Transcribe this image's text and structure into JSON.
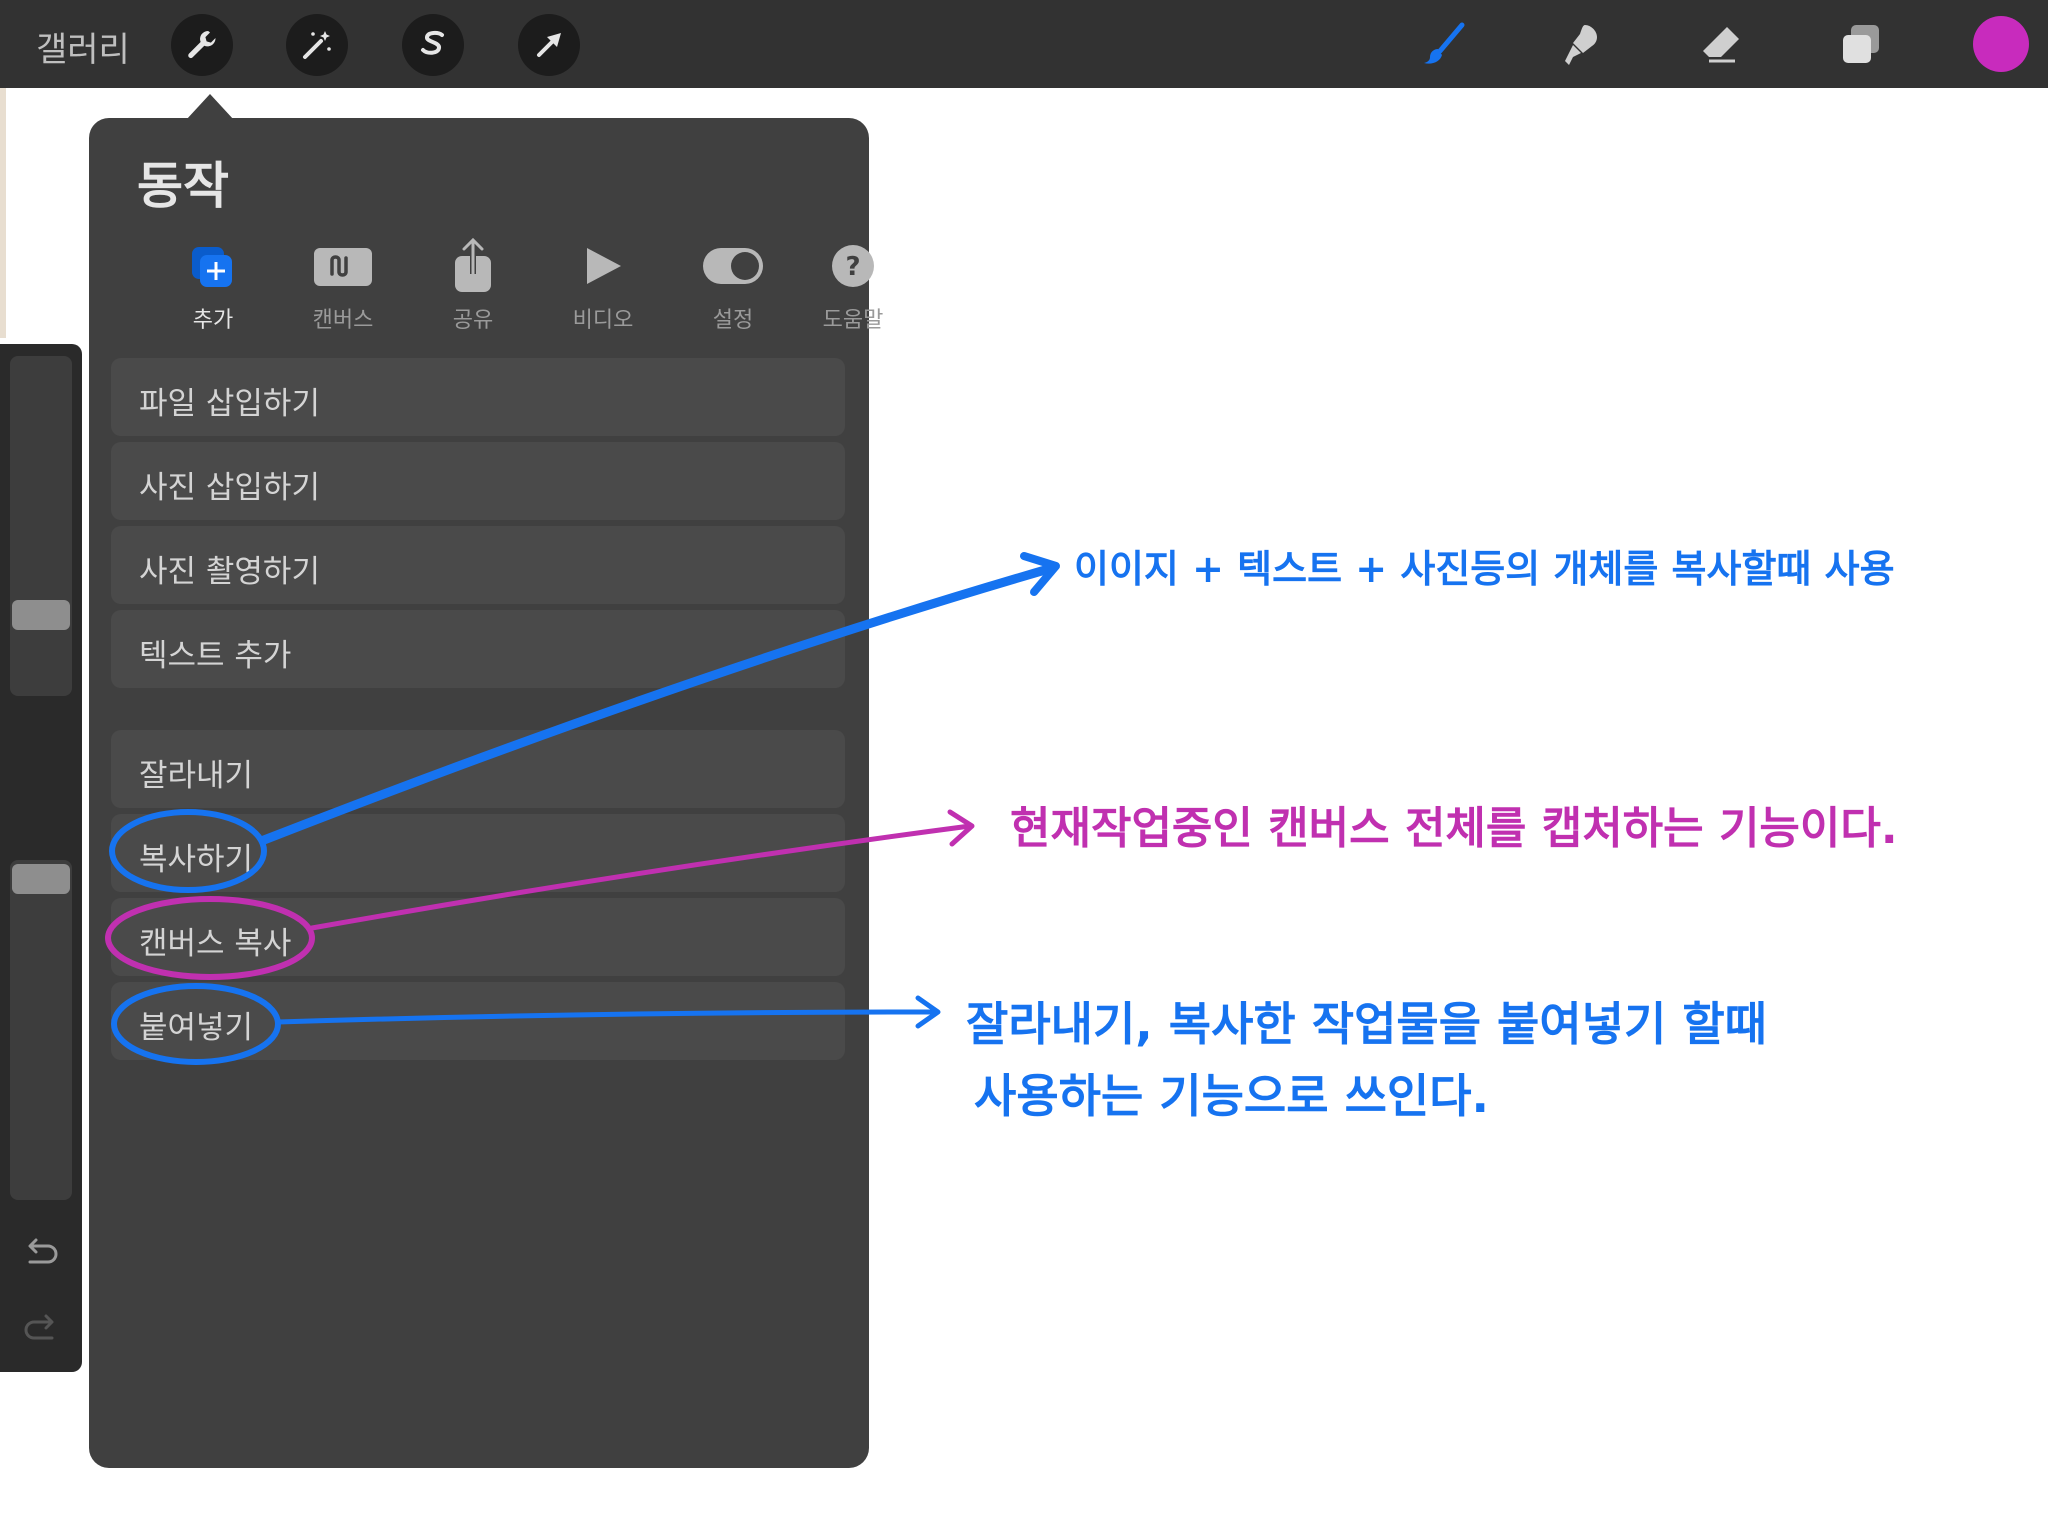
{
  "topbar": {
    "gallery_label": "갤러리",
    "left_tools": [
      {
        "name": "wrench-icon"
      },
      {
        "name": "magic-wand-icon"
      },
      {
        "name": "selection-s-icon"
      },
      {
        "name": "transform-arrow-icon"
      }
    ],
    "right_tools": [
      {
        "name": "brush-icon"
      },
      {
        "name": "smudge-icon"
      },
      {
        "name": "eraser-icon"
      },
      {
        "name": "layers-icon"
      }
    ],
    "current_color": "#c82bbd",
    "active_brush_color": "#1673f0"
  },
  "popover": {
    "title": "동작",
    "tabs": [
      {
        "label": "추가",
        "icon": "add-icon",
        "active": true
      },
      {
        "label": "캔버스",
        "icon": "canvas-icon",
        "active": false
      },
      {
        "label": "공유",
        "icon": "share-icon",
        "active": false
      },
      {
        "label": "비디오",
        "icon": "play-icon",
        "active": false
      },
      {
        "label": "설정",
        "icon": "toggle-icon",
        "active": false
      },
      {
        "label": "도움말",
        "icon": "help-icon",
        "active": false
      }
    ],
    "group1": [
      {
        "label": "파일 삽입하기"
      },
      {
        "label": "사진 삽입하기"
      },
      {
        "label": "사진 촬영하기"
      },
      {
        "label": "텍스트 추가"
      }
    ],
    "group2": [
      {
        "label": "잘라내기"
      },
      {
        "label": "복사하기"
      },
      {
        "label": "캔버스 복사"
      },
      {
        "label": "붙여넣기"
      }
    ]
  },
  "annotations": {
    "copy_note": "이이지 + 텍스트 + 사진등의 개체를  복사할때 사용",
    "canvas_copy_note": "현재작업중인 캔버스 전체를 캡처하는 기능이다.",
    "paste_note_line1": "잘라내기, 복사한 작업물을 붙여넣기 할때",
    "paste_note_line2": "사용하는 기능으로 쓰인다.",
    "blue": "#1673f0",
    "purple": "#c030b0"
  }
}
